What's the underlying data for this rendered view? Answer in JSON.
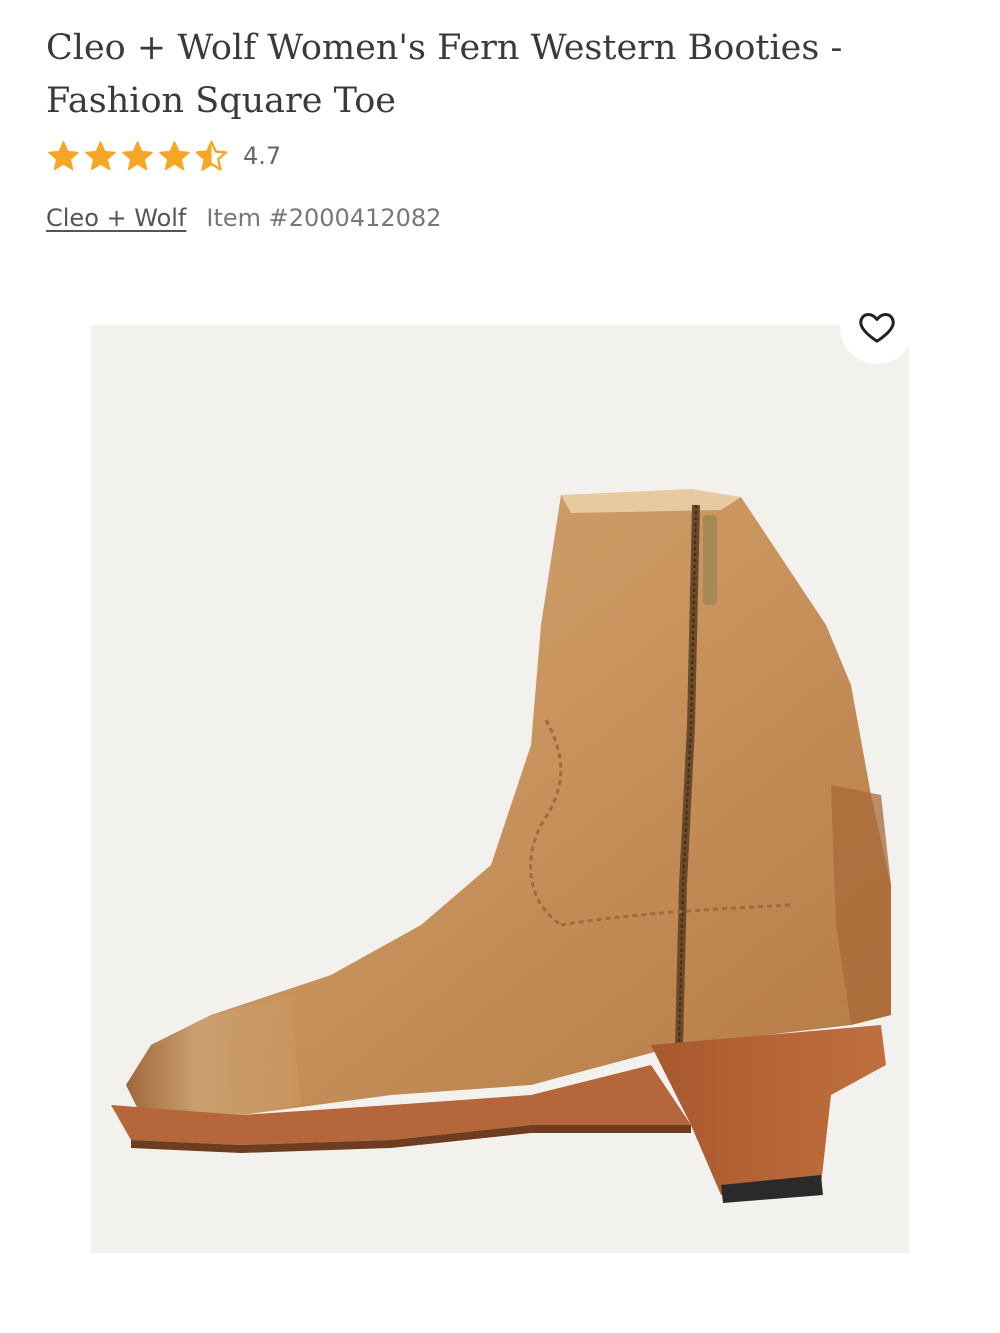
{
  "product": {
    "title": "Cleo + Wolf Women's Fern Western Booties - Fashion Square Toe",
    "rating": 4.7,
    "rating_text": "4.7",
    "brand": "Cleo + Wolf",
    "item_number": "Item #2000412082"
  },
  "icons": {
    "rating": "star-icon",
    "favorite": "heart-icon"
  },
  "colors": {
    "star": "#f6a623",
    "image_bg": "#f3f1ee"
  }
}
